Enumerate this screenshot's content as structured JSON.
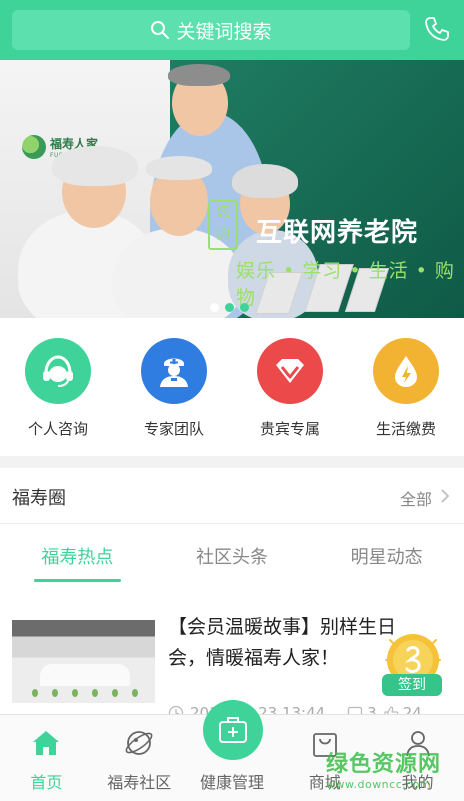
{
  "header": {
    "search_placeholder": "关键词搜索",
    "phone_icon": "phone-icon"
  },
  "banner": {
    "brand_name": "福寿人家",
    "brand_pinyin": "FUSHOURENJIA",
    "slogan_box": [
      "您",
      "的"
    ],
    "slogan": "互联网养老院",
    "tags": "娱乐 • 学习 • 生活 • 购物",
    "slide_count": 3,
    "active_slide": 2
  },
  "services": [
    {
      "label": "个人咨询",
      "icon": "headset-icon",
      "color": "#3fd39a"
    },
    {
      "label": "专家团队",
      "icon": "doctor-icon",
      "color": "#2f7de0"
    },
    {
      "label": "贵宾专属",
      "icon": "vip-icon",
      "color": "#ec4a4a"
    },
    {
      "label": "生活缴费",
      "icon": "utility-icon",
      "color": "#f2b332"
    }
  ],
  "circle": {
    "title": "福寿圈",
    "all_label": "全部"
  },
  "tabs": [
    {
      "label": "福寿热点",
      "active": true
    },
    {
      "label": "社区头条",
      "active": false
    },
    {
      "label": "明星动态",
      "active": false
    }
  ],
  "article": {
    "title": "【会员温暖故事】别样生日会，情暖福寿人家！",
    "time": "2016-08-23 13:44",
    "comments": "3",
    "likes": "24"
  },
  "signin": {
    "label": "签到"
  },
  "nav": [
    {
      "label": "首页",
      "icon": "home-icon",
      "active": true
    },
    {
      "label": "福寿社区",
      "icon": "planet-icon",
      "active": false
    },
    {
      "label": "健康管理",
      "icon": "medical-kit-icon",
      "active": false
    },
    {
      "label": "商城",
      "icon": "shopping-bag-icon",
      "active": false
    },
    {
      "label": "我的",
      "icon": "user-icon",
      "active": false
    }
  ],
  "watermark": {
    "cn": "绿色资源网",
    "en": "www.downcc.com"
  },
  "colors": {
    "accent": "#3fd39a"
  }
}
